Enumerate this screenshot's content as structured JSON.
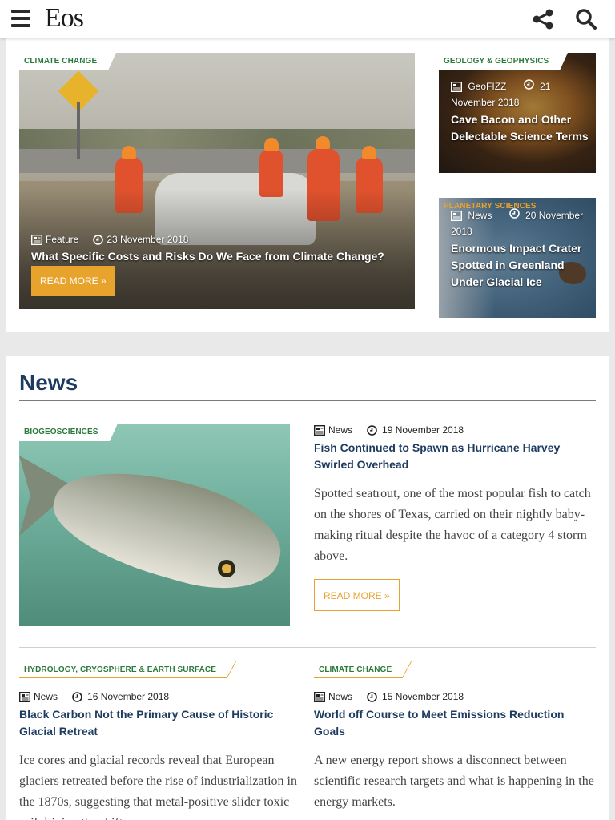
{
  "header": {
    "logo": "Eos",
    "menu_icon": "hamburger-icon",
    "share_icon": "share-icon",
    "search_icon": "search-icon"
  },
  "colors": {
    "accent": "#e8a32c",
    "tag_green": "#2a7a3b",
    "title_blue": "#1d3a5f"
  },
  "featured": {
    "main": {
      "tag": "CLIMATE CHANGE",
      "type": "Feature",
      "date": "23 November 2018",
      "title": "What Specific Costs and Risks Do We Face from Climate Change?",
      "read_more": "READ MORE »"
    },
    "side": [
      {
        "tag": "GEOLOGY & GEOPHYSICS",
        "type": "GeoFIZZ",
        "date": "21 November 2018",
        "title": "Cave Bacon and Other Delectable Science Terms"
      },
      {
        "tag": "PLANETARY SCIENCES",
        "type": "News",
        "date": "20 November 2018",
        "title": "Enormous Impact Crater Spotted in Greenland Under Glacial Ice"
      }
    ]
  },
  "news": {
    "heading": "News",
    "lead": {
      "tag": "BIOGEOSCIENCES",
      "type": "News",
      "date": "19 November 2018",
      "title": "Fish Continued to Spawn as Hurricane Harvey Swirled Overhead",
      "body": "Spotted seatrout, one of the most popular fish to catch on the shores of Texas, carried on their nightly baby-making ritual despite the havoc of a category 4 storm above.",
      "read_more": "READ MORE »"
    },
    "items": [
      {
        "tag": "HYDROLOGY, CRYOSPHERE & EARTH SURFACE",
        "type": "News",
        "date": "16 November 2018",
        "title": "Black Carbon Not the Primary Cause of Historic Glacial Retreat",
        "body": "Ice cores and glacial records reveal that European glaciers retreated before the rise of industrialization in the 1870s, suggesting that metal-positive slider toxic soil driving the shift"
      },
      {
        "tag": "CLIMATE CHANGE",
        "type": "News",
        "date": "15 November 2018",
        "title": "World off Course to Meet Emissions Reduction Goals",
        "body": "A new energy report shows a disconnect between scientific research targets and what is happening in the energy markets."
      }
    ]
  }
}
